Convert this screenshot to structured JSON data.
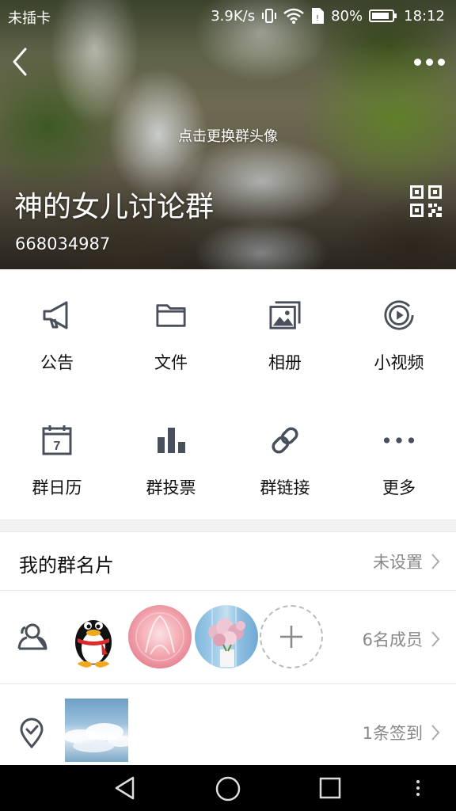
{
  "status_bar": {
    "carrier": "未插卡",
    "speed": "3.9K/s",
    "battery": "80%",
    "time": "18:12"
  },
  "header": {
    "change_avatar_hint": "点击更换群头像",
    "group_name": "神的女儿讨论群",
    "group_id": "668034987",
    "icons": {
      "back": "back-arrow-icon",
      "more": "more-dots-icon",
      "qr": "qr-code-icon"
    }
  },
  "functions": [
    {
      "label": "公告",
      "icon": "megaphone-icon"
    },
    {
      "label": "文件",
      "icon": "folder-icon"
    },
    {
      "label": "相册",
      "icon": "album-icon"
    },
    {
      "label": "小视频",
      "icon": "video-icon"
    },
    {
      "label": "群日历",
      "icon": "calendar-icon"
    },
    {
      "label": "群投票",
      "icon": "bar-chart-icon"
    },
    {
      "label": "群链接",
      "icon": "link-icon"
    },
    {
      "label": "更多",
      "icon": "more-horizontal-icon"
    }
  ],
  "calendar_day": "7",
  "my_card": {
    "title": "我的群名片",
    "value": "未设置"
  },
  "members": {
    "count_label": "6名成员"
  },
  "checkin": {
    "count_label": "1条签到"
  },
  "colors": {
    "icon_gray": "#4a4f5c",
    "text_gray": "#888888",
    "accent_red": "#d92b2b"
  }
}
